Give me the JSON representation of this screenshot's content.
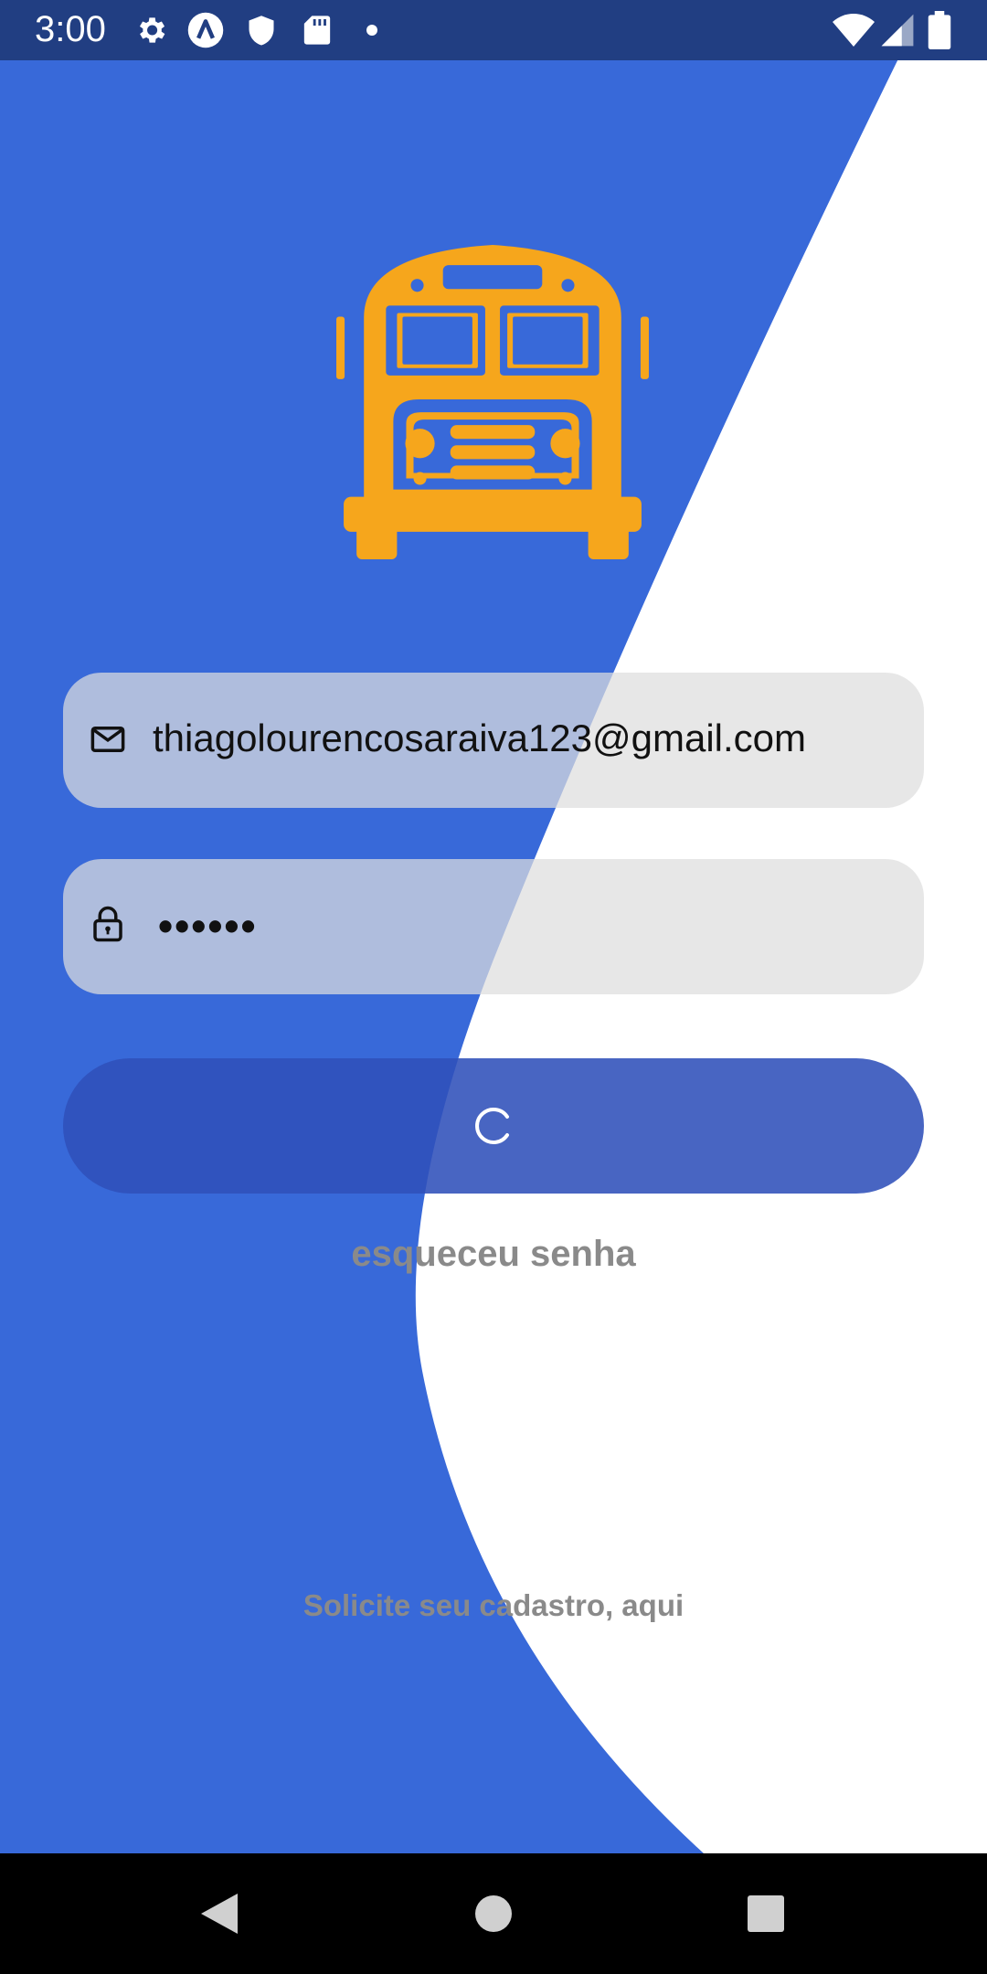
{
  "status_bar": {
    "time": "3:00",
    "left_icons": [
      "gear-icon",
      "autofill-icon",
      "shield-icon",
      "sd-card-icon",
      "dot-icon"
    ],
    "right_icons": [
      "wifi-icon",
      "cellular-signal-icon",
      "battery-icon"
    ]
  },
  "colors": {
    "background_blue": "#3869d9",
    "status_bar": "#213e82",
    "bus_logo": "#f6a61c",
    "input_fill": "#e4e4e4",
    "button": "#2f50b9",
    "link_text": "#8a8a8a"
  },
  "logo": {
    "icon": "school-bus-icon"
  },
  "login_form": {
    "email": {
      "value": "thiagolourencosaraiva123@gmail.com",
      "icon": "mail-icon"
    },
    "password": {
      "value": "••••••",
      "icon": "lock-icon"
    },
    "submit": {
      "state": "loading",
      "icon": "spinner-icon"
    },
    "forgot_password_label": "esqueceu senha",
    "signup_label": "Solicite seu cadastro, aqui"
  },
  "nav_bar": {
    "buttons": [
      "back-icon",
      "home-icon",
      "recents-icon"
    ]
  }
}
